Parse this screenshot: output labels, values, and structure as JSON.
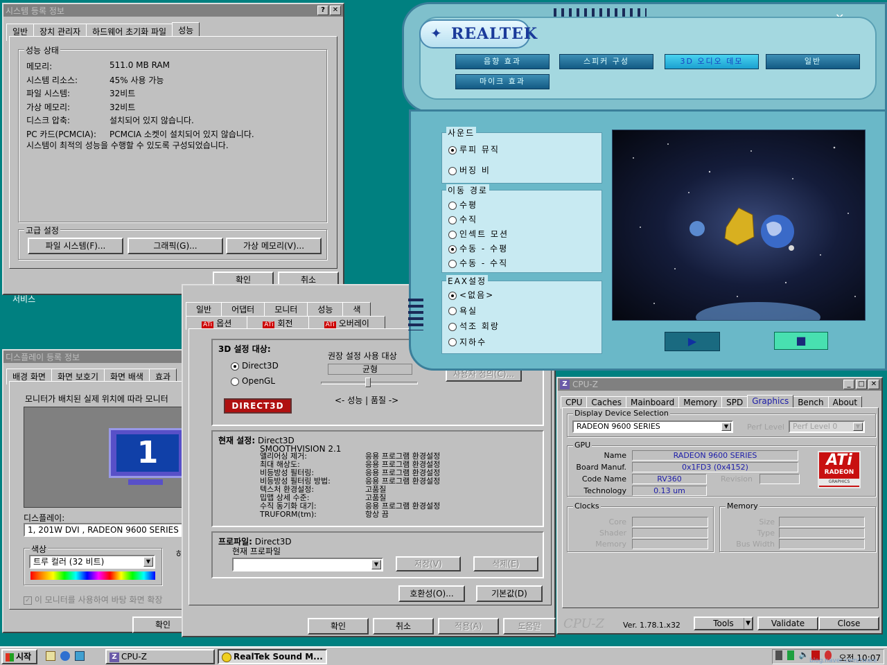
{
  "sysprops": {
    "title": "시스템 등록 정보",
    "tabs": [
      "일반",
      "장치 관리자",
      "하드웨어 초기화 파일",
      "성능"
    ],
    "status_group": "성능 상태",
    "rows": [
      {
        "label": "메모리:",
        "value": "511.0 MB RAM"
      },
      {
        "label": "시스템 리소스:",
        "value": "45% 사용 가능"
      },
      {
        "label": "파일 시스템:",
        "value": "32비트"
      },
      {
        "label": "가상 메모리:",
        "value": "32비트"
      },
      {
        "label": "디스크 압축:",
        "value": "설치되어 있지 않습니다."
      },
      {
        "label": "PC 카드(PCMCIA):",
        "value": "PCMCIA 소켓이 설치되어 있지 않습니다."
      }
    ],
    "message": "시스템이 최적의 성능을 수행할 수 있도록 구성되었습니다.",
    "advanced_group": "고급 설정",
    "btn_filesystem": "파일 시스템(F)...",
    "btn_graphics": "그래픽(G)...",
    "btn_virtualmem": "가상 메모리(V)...",
    "ok": "확인",
    "cancel": "취소"
  },
  "desktop_label": "서비스",
  "display": {
    "title": "디스플레이 등록 정보",
    "tabs": [
      "배경 화면",
      "화면 보호기",
      "화면 배색",
      "효과"
    ],
    "instruction": "모니터가 배치된 실제 위치에 따라 모니터",
    "monitor_number": "1",
    "display_label": "디스플레이:",
    "display_value": "1, 201W DVI , RADEON 9600 SERIES",
    "color_label": "색상",
    "color_value": "트루 컬러 (32 비트)",
    "resolution_label_partial": "하",
    "extend_checkbox": "이 모니터를 사용하여 바탕 화면 확장",
    "ok": "확인"
  },
  "ati": {
    "tabs_row1": [
      "일반",
      "어댑터",
      "모니터",
      "성능",
      "색"
    ],
    "tabs_row2": [
      "옵션",
      "회전",
      "오버레이"
    ],
    "group_3d": "3D 설정 대상:",
    "radio_direct3d": "Direct3D",
    "radio_opengl": "OpenGL",
    "logo_text": "DIRECT3D",
    "recommended": "권장 설정 사용 대상",
    "balance": "균형",
    "slider_caption": "<- 성능  |  품질  ->",
    "custom_btn": "사용자 정의(C)...",
    "current_label": "현재 설정:",
    "current_value": "Direct3D",
    "smoothvision": "SMOOTHVISION 2.1",
    "settings": [
      {
        "name": "앨리어싱 제거:",
        "value": "응용 프로그램 환경설정"
      },
      {
        "name": "최대 해상도:",
        "value": "응용 프로그램 환경설정"
      },
      {
        "name": "비등방성 필터링:",
        "value": "응용 프로그램 환경설정"
      },
      {
        "name": "비등방성 필터링 방법:",
        "value": "응용 프로그램 환경설정"
      },
      {
        "name": "텍스처 환경설정:",
        "value": "고품질"
      },
      {
        "name": "밉맵 상세 수준:",
        "value": "고품질"
      },
      {
        "name": "수직 동기화 대기:",
        "value": "응용 프로그램 환경설정"
      },
      {
        "name": "TRUFORM(tm):",
        "value": "항상 끔"
      }
    ],
    "profile_label": "프로파일:",
    "profile_value": "Direct3D",
    "current_profile": "현재 프로파일",
    "save_btn": "저장(V)",
    "delete_btn": "삭제(E)",
    "compat_btn": "호환성(O)...",
    "defaults_btn": "기본값(D)",
    "ok": "확인",
    "cancel": "취소",
    "apply": "적용(A)",
    "help": "도움말"
  },
  "realtek": {
    "brand": "REALTEK",
    "buttons": [
      "음향 효과",
      "스피커 구성",
      "3D 오디오 데모",
      "일반",
      "마이크 효과"
    ],
    "sound_group": "사운드",
    "sound_options": [
      "루피 뮤직",
      "버징 비"
    ],
    "sound_selected": 0,
    "path_group": "이동 경로",
    "path_options": [
      "수평",
      "수직",
      "인섹트 모션",
      "수동 - 수평",
      "수동 - 수직"
    ],
    "path_selected": 3,
    "eax_group": "EAX설정",
    "eax_options": [
      "<없음>",
      "욕실",
      "석조 회랑",
      "지하수"
    ],
    "eax_selected": 0,
    "play_icon": "play-icon",
    "stop_icon": "stop-icon"
  },
  "cpuz": {
    "title": "CPU-Z",
    "tabs": [
      "CPU",
      "Caches",
      "Mainboard",
      "Memory",
      "SPD",
      "Graphics",
      "Bench",
      "About"
    ],
    "active_tab": "Graphics",
    "display_selection": "Display Device Selection",
    "device": "RADEON 9600 SERIES",
    "perf_level_label": "Perf Level",
    "perf_level_value": "Perf Level 0",
    "gpu_group": "GPU",
    "name_label": "Name",
    "name_value": "RADEON 9600 SERIES",
    "board_label": "Board Manuf.",
    "board_value": "0x1FD3 (0x4152)",
    "code_label": "Code Name",
    "code_value": "RV360",
    "revision_label": "Revision",
    "tech_label": "Technology",
    "tech_value": "0.13 um",
    "ati_logo": "ATi",
    "ati_sub": "RADEON",
    "ati_sub2": "GRAPHICS",
    "clocks_group": "Clocks",
    "clock_core": "Core",
    "clock_shader": "Shader",
    "clock_memory": "Memory",
    "memory_group": "Memory",
    "mem_size": "Size",
    "mem_type": "Type",
    "mem_bus": "Bus Width",
    "brand": "CPU-Z",
    "version": "Ver. 1.78.1.x32",
    "tools": "Tools",
    "validate": "Validate",
    "close": "Close"
  },
  "taskbar": {
    "start": "시작",
    "tasks": [
      "CPU-Z",
      "RealTek Sound M..."
    ],
    "clock": "오전 10:07",
    "watermark": "blog.naver.com/tware"
  }
}
